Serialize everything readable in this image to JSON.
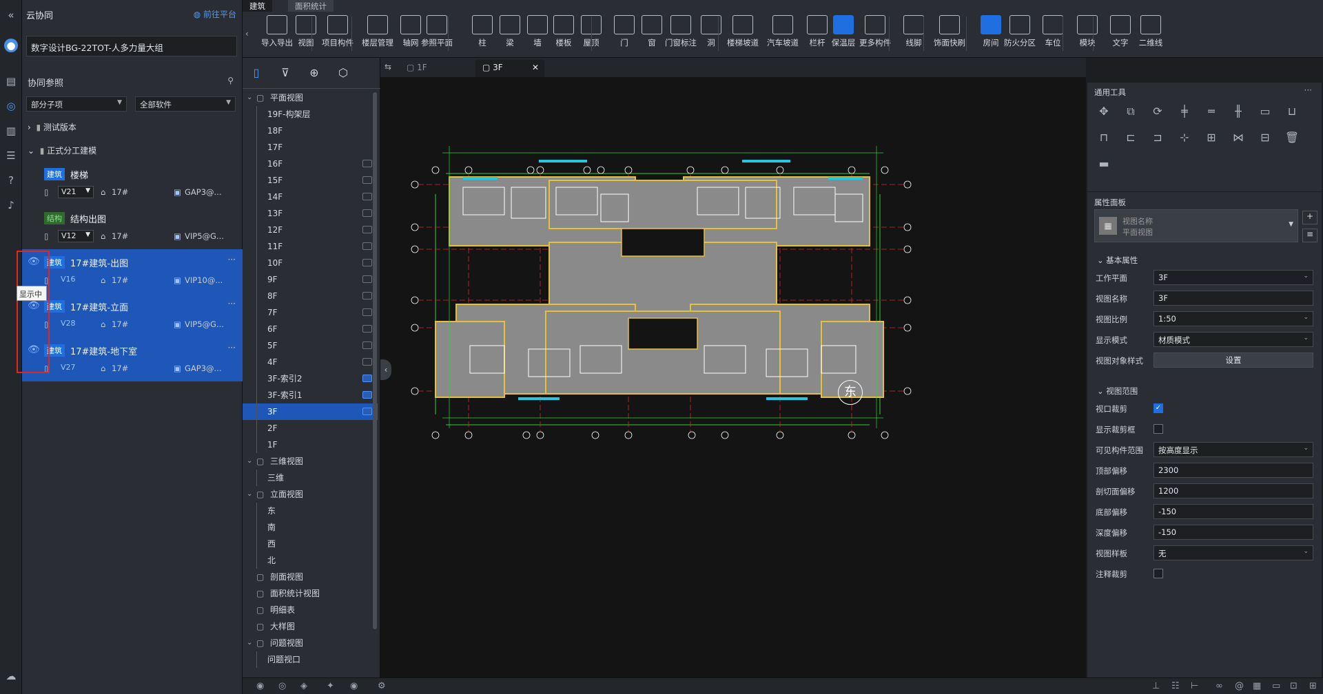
{
  "left_rail": {
    "icons": [
      "collapse-icon",
      "avatar-icon",
      "list-icon",
      "collab-icon",
      "folder-icon",
      "layers-icon",
      "help-icon",
      "bell-icon",
      "cloud-upload-icon"
    ]
  },
  "collab": {
    "title": "云协同",
    "platform_link": "前往平台",
    "project_name": "数字设计BG-22TOT-人多力量大组",
    "section_title": "协同参照",
    "filter_scope": "部分子项",
    "filter_software": "全部软件",
    "tree": [
      {
        "label": "测试版本",
        "expanded": false
      },
      {
        "label": "正式分工建模",
        "expanded": true
      }
    ],
    "items": [
      {
        "tag": "建筑",
        "tag_color": "#1f6fe0",
        "name": "楼梯",
        "version": "V21",
        "building": "17#",
        "owner": "GAP3@...",
        "selected": false
      },
      {
        "tag": "结构",
        "tag_color": "#2f6b2f",
        "name": "结构出图",
        "version": "V12",
        "building": "17#",
        "owner": "VIP5@G...",
        "selected": false
      },
      {
        "tag": "建筑",
        "tag_color": "#1f6fe0",
        "name": "17#建筑-出图",
        "version": "V16",
        "building": "17#",
        "owner": "VIP10@...",
        "selected": true
      },
      {
        "tag": "建筑",
        "tag_color": "#1f6fe0",
        "name": "17#建筑-立面",
        "version": "V28",
        "building": "17#",
        "owner": "VIP5@G...",
        "selected": true
      },
      {
        "tag": "建筑",
        "tag_color": "#1f6fe0",
        "name": "17#建筑-地下室",
        "version": "V27",
        "building": "17#",
        "owner": "GAP3@...",
        "selected": true
      }
    ],
    "tooltip": "显示中"
  },
  "toolbar": {
    "tabs": [
      "建筑",
      "面积统计"
    ],
    "buttons": [
      "导入导出",
      "视图",
      "项目构件",
      "楼层管理",
      "轴网",
      "参照平面",
      "柱",
      "梁",
      "墙",
      "楼板",
      "屋顶",
      "门",
      "窗",
      "门窗标注",
      "洞",
      "楼梯坡道",
      "汽车坡道",
      "栏杆",
      "保温层",
      "更多构件",
      "线脚",
      "饰面快刷",
      "房间",
      "防火分区",
      "车位",
      "模块",
      "文字",
      "二维线"
    ]
  },
  "browser": {
    "tools": [
      "panel-icon",
      "filter-icon",
      "location-icon",
      "cube-icon"
    ],
    "rows": [
      {
        "label": "平面视图",
        "level": 0,
        "group": true
      },
      {
        "label": "19F-构架层",
        "level": 1
      },
      {
        "label": "18F",
        "level": 1
      },
      {
        "label": "17F",
        "level": 1
      },
      {
        "label": "16F",
        "level": 1,
        "icon": true
      },
      {
        "label": "15F",
        "level": 1,
        "icon": true
      },
      {
        "label": "14F",
        "level": 1,
        "icon": true
      },
      {
        "label": "13F",
        "level": 1,
        "icon": true
      },
      {
        "label": "12F",
        "level": 1,
        "icon": true
      },
      {
        "label": "11F",
        "level": 1,
        "icon": true
      },
      {
        "label": "10F",
        "level": 1,
        "icon": true
      },
      {
        "label": "9F",
        "level": 1,
        "icon": true
      },
      {
        "label": "8F",
        "level": 1,
        "icon": true
      },
      {
        "label": "7F",
        "level": 1,
        "icon": true
      },
      {
        "label": "6F",
        "level": 1,
        "icon": true
      },
      {
        "label": "5F",
        "level": 1,
        "icon": true
      },
      {
        "label": "4F",
        "level": 1,
        "icon": true
      },
      {
        "label": "3F-索引2",
        "level": 1,
        "icon": true,
        "blue": true
      },
      {
        "label": "3F-索引1",
        "level": 1,
        "icon": true,
        "blue": true
      },
      {
        "label": "3F",
        "level": 1,
        "icon": true,
        "active": true,
        "blue": true
      },
      {
        "label": "2F",
        "level": 1
      },
      {
        "label": "1F",
        "level": 1
      },
      {
        "label": "三维视图",
        "level": 0,
        "group": true
      },
      {
        "label": "三维",
        "level": 1
      },
      {
        "label": "立面视图",
        "level": 0,
        "group": true
      },
      {
        "label": "东",
        "level": 1
      },
      {
        "label": "南",
        "level": 1
      },
      {
        "label": "西",
        "level": 1
      },
      {
        "label": "北",
        "level": 1
      },
      {
        "label": "剖面视图",
        "level": 0
      },
      {
        "label": "面积统计视图",
        "level": 0
      },
      {
        "label": "明细表",
        "level": 0
      },
      {
        "label": "大样图",
        "level": 0
      },
      {
        "label": "问题视图",
        "level": 0,
        "group": true
      },
      {
        "label": "问题视口",
        "level": 1
      }
    ]
  },
  "canvas": {
    "tabs": [
      {
        "label": "1F",
        "active": false
      },
      {
        "label": "3F",
        "active": true
      }
    ],
    "compass_label": "东"
  },
  "right": {
    "tools_title": "通用工具",
    "props_title": "属性面板",
    "type_name": "视图名称",
    "type_sub": "平面视图",
    "basic_title": "基本属性",
    "range_title": "视图范围",
    "basic": [
      {
        "label": "工作平面",
        "value": "3F",
        "kind": "select"
      },
      {
        "label": "视图名称",
        "value": "3F",
        "kind": "input"
      },
      {
        "label": "视图比例",
        "value": "1:50",
        "kind": "select"
      },
      {
        "label": "显示模式",
        "value": "材质模式",
        "kind": "select"
      },
      {
        "label": "视图对象样式",
        "value": "设置",
        "kind": "button"
      }
    ],
    "range": [
      {
        "label": "视口裁剪",
        "value": true,
        "kind": "check"
      },
      {
        "label": "显示裁剪框",
        "value": false,
        "kind": "check"
      },
      {
        "label": "可见构件范围",
        "value": "按高度显示",
        "kind": "select"
      },
      {
        "label": "顶部偏移",
        "value": "2300",
        "kind": "input"
      },
      {
        "label": "剖切面偏移",
        "value": "1200",
        "kind": "input"
      },
      {
        "label": "底部偏移",
        "value": "-150",
        "kind": "input"
      },
      {
        "label": "深度偏移",
        "value": "-150",
        "kind": "input"
      },
      {
        "label": "视图样板",
        "value": "无",
        "kind": "select"
      },
      {
        "label": "注释裁剪",
        "value": false,
        "kind": "check"
      }
    ]
  }
}
